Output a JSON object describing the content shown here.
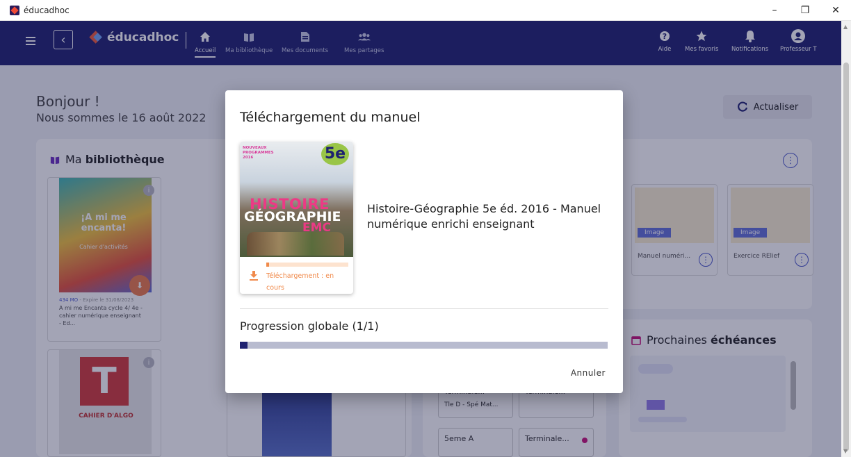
{
  "window": {
    "title": "éducadhoc",
    "controls": [
      "–",
      "❐",
      "✕"
    ]
  },
  "header": {
    "brand": "éducadhoc",
    "nav": [
      {
        "label": "Accueil",
        "icon": "home-icon",
        "active": true
      },
      {
        "label": "Ma bibliothèque",
        "icon": "library-icon"
      },
      {
        "label": "Mes documents",
        "icon": "document-icon"
      },
      {
        "label": "Mes partages",
        "icon": "users-icon"
      }
    ],
    "right_nav": [
      {
        "label": "Aide",
        "icon": "help-icon"
      },
      {
        "label": "Mes favoris",
        "icon": "star-icon"
      },
      {
        "label": "Notifications",
        "icon": "bell-icon"
      },
      {
        "label": "Professeur T",
        "icon": "user-avatar-icon"
      }
    ]
  },
  "main": {
    "greeting": "Bonjour !",
    "date_line": "Nous sommes le 16 août 2022",
    "refresh_label": "Actualiser",
    "library": {
      "title_prefix": "Ma",
      "title_bold": "bibliothèque",
      "books": [
        {
          "size": "434 MO",
          "expiry": " - Expire le 31/08/2023",
          "title": "A mi me Encanta cycle 4/ 4e - cahier numérique enseignant - Ed...",
          "cover_title": "¡A mi me encanta!",
          "cover_sub": "Cahier d'activités"
        },
        {
          "cover_title": "T",
          "cover_sub": "CAHIER D'ALGO"
        }
      ]
    },
    "documents": [
      {
        "tag": "Image",
        "caption": "Manuel numéri..."
      },
      {
        "tag": "Image",
        "caption": "Exercice RElief"
      }
    ],
    "classes": [
      {
        "name": "Terminale...",
        "sub": "Tle D - Spé Mat..."
      },
      {
        "name": "Terminale...",
        "sub": ""
      },
      {
        "name": "5eme A",
        "sub": ""
      },
      {
        "name": "Terminale...",
        "sub": ""
      }
    ],
    "deadlines": {
      "title_prefix": "Prochaines",
      "title_bold": "échéances"
    }
  },
  "dialog": {
    "title": "Téléchargement du manuel",
    "book_name": "Histoire-Géographie 5e éd. 2016 - Manuel numérique enrichi enseignant",
    "cover": {
      "grade": "5e",
      "new_badge": "NOUVEAUX PROGRAMMES 2016",
      "line1": "HISTOIRE",
      "line2": "GÉOGRAPHIE",
      "line3": "EMC"
    },
    "item_progress": 0.03,
    "status": "Téléchargement : en cours",
    "global_label": "Progression globale (1/1)",
    "global_progress": 0.02,
    "cancel_label": "Annuler"
  },
  "colors": {
    "brand": "#1e2170",
    "accent": "#f08a4b",
    "link": "#4553c8"
  }
}
